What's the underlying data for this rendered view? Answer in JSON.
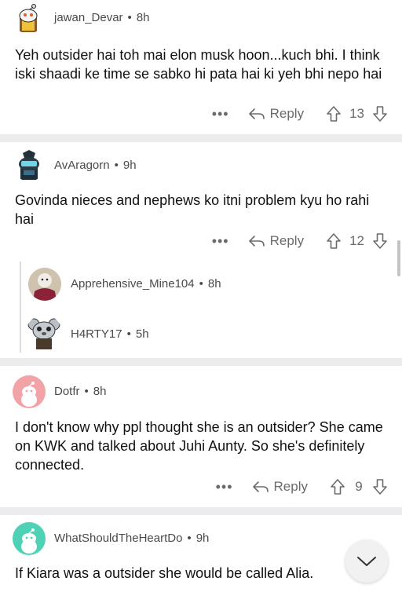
{
  "comments": [
    {
      "username": "jawan_Devar",
      "age": "8h",
      "body": "Yeh outsider hai toh mai elon musk hoon...kuch bhi. I think iski shaadi ke time se sabko hi pata hai ki yeh bhi nepo hai",
      "more": "•••",
      "reply_label": "Reply",
      "score": "13"
    },
    {
      "username": "AvAragorn",
      "age": "9h",
      "body": "Govinda nieces and nephews ko itni problem kyu ho rahi hai",
      "more": "•••",
      "reply_label": "Reply",
      "score": "12"
    },
    {
      "username": "Dotfr",
      "age": "8h",
      "body": "I don't know why ppl thought she is an outsider? She came on KWK and talked about Juhi Aunty. So she's definitely connected.",
      "more": "•••",
      "reply_label": "Reply",
      "score": "9"
    },
    {
      "username": "WhatShouldTheHeartDo",
      "age": "9h",
      "body": "If Kiara was a outsider she would be called Alia."
    }
  ],
  "collapsed_replies": [
    {
      "username": "Apprehensive_Mine104",
      "age": "8h"
    },
    {
      "username": "H4RTY17",
      "age": "5h"
    }
  ],
  "colors": {
    "separator": "#ececee",
    "meta_text": "#4a4a4c",
    "action_text": "#6b6b6e",
    "dotfr_avatar": "#f2a3a8",
    "heart_avatar": "#4fd1b6"
  },
  "icons": [
    "reply-icon",
    "upvote-icon",
    "downvote-icon",
    "more-icon",
    "chevron-down-icon"
  ]
}
